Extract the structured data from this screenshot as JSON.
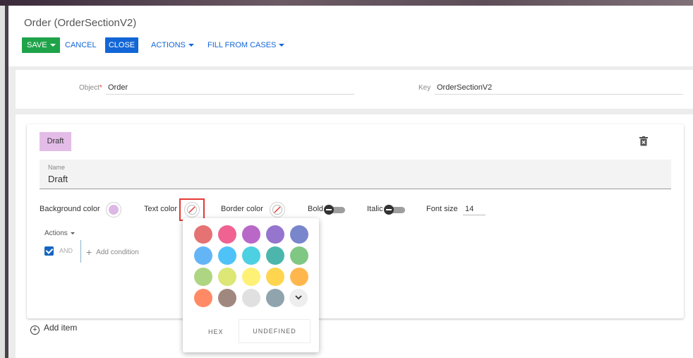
{
  "header": {
    "title": "Order (OrderSectionV2)",
    "buttons": {
      "save": "SAVE",
      "cancel": "CANCEL",
      "close": "CLOSE",
      "actions": "ACTIONS",
      "fill_from_cases": "FILL FROM CASES"
    }
  },
  "form": {
    "object_label": "Object",
    "object_required": "*",
    "object_value": "Order",
    "key_label": "Key",
    "key_value": "OrderSectionV2"
  },
  "item": {
    "chip_label": "Draft",
    "chip_color": "#e3bce8",
    "name_label": "Name",
    "name_value": "Draft",
    "props": {
      "background_color_label": "Background color",
      "background_color_value": "#ddb7e6",
      "text_color_label": "Text color",
      "border_color_label": "Border color",
      "bold_label": "Bold",
      "italic_label": "Italic",
      "font_size_label": "Font size",
      "font_size_value": "14"
    },
    "actions_label": "Actions",
    "condition": {
      "operator": "AND",
      "add_condition": "Add condition",
      "checked": true
    }
  },
  "add_item": "Add item",
  "color_popup": {
    "palette": [
      "#e57373",
      "#f06292",
      "#ba68c8",
      "#9575cd",
      "#7986cb",
      "#64b5f6",
      "#4fc3f7",
      "#4dd0e1",
      "#4db6ac",
      "#81c784",
      "#aed581",
      "#dce775",
      "#fff176",
      "#ffd54f",
      "#ffb74d",
      "#ff8a65",
      "#a1887f",
      "#e0e0e0",
      "#90a4ae"
    ],
    "hex_label": "HEX",
    "undefined_label": "UNDEFINED"
  },
  "icons": [
    "trash-icon",
    "no-color-icon",
    "chevron-down-icon",
    "plus-icon",
    "add-circle-icon",
    "check-icon"
  ]
}
